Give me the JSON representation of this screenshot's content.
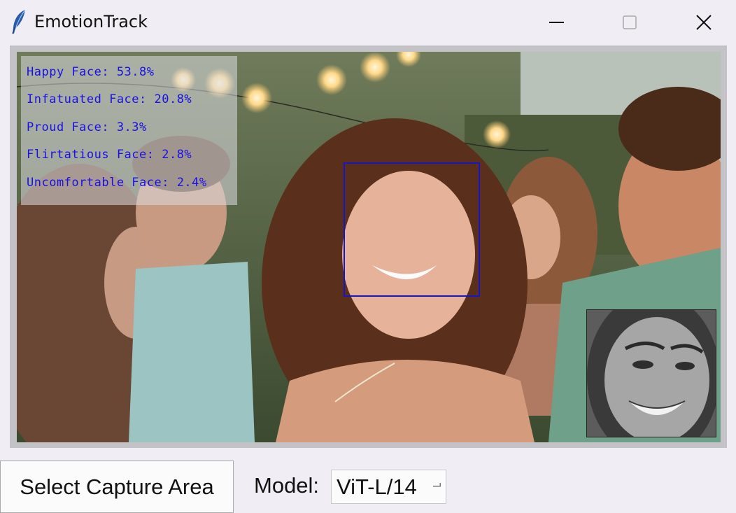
{
  "window": {
    "title": "EmotionTrack",
    "icon": "feather-icon"
  },
  "titlebar_buttons": [
    "minimize-icon",
    "maximize-icon",
    "close-icon"
  ],
  "overlay": {
    "emotions": [
      {
        "label": "Happy Face: 53.8%"
      },
      {
        "label": "Infatuated Face: 20.8%"
      },
      {
        "label": "Proud Face: 3.3%"
      },
      {
        "label": "Flirtatious Face: 2.8%"
      },
      {
        "label": "Uncomfortable Face: 2.4%"
      }
    ],
    "text_color": "#1a10e6",
    "face_box_color": "#1a14c8"
  },
  "controls": {
    "select_button": "Select Capture Area",
    "model_label": "Model:",
    "model_value": "ViT-L/14"
  }
}
